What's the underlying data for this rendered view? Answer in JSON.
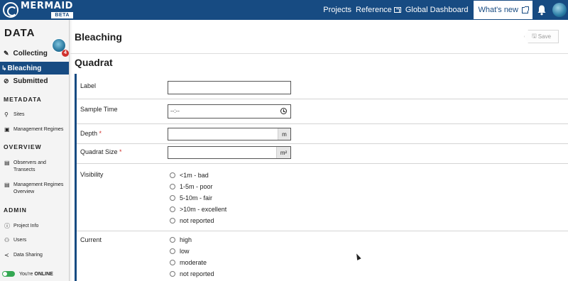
{
  "brand": {
    "name": "MERMAID",
    "badge": "BETA"
  },
  "nav": {
    "projects": "Projects",
    "reference": "Reference",
    "global_dashboard": "Global Dashboard",
    "whats_new": "What's new"
  },
  "sidebar": {
    "title": "DATA",
    "badge_count": "4",
    "collecting": "Collecting",
    "bleaching": "Bleaching",
    "submitted": "Submitted",
    "metadata_heading": "METADATA",
    "sites": "Sites",
    "management_regimes": "Management Regimes",
    "overview_heading": "OVERVIEW",
    "observers_transects": "Observers and Transects",
    "mr_overview": "Management Regimes Overview",
    "admin_heading": "ADMIN",
    "project_info": "Project Info",
    "users": "Users",
    "data_sharing": "Data Sharing",
    "online_prefix": "You're",
    "online_status": "ONLINE"
  },
  "page": {
    "title": "Bleaching",
    "save_label": "Save"
  },
  "form": {
    "section_title": "Quadrat",
    "label": {
      "label": "Label",
      "value": ""
    },
    "sample_time": {
      "label": "Sample Time",
      "value": "--:--"
    },
    "depth": {
      "label": "Depth",
      "required": "*",
      "unit": "m",
      "value": ""
    },
    "quadrat_size": {
      "label": "Quadrat Size",
      "required": "*",
      "unit": "m²",
      "value": ""
    },
    "visibility": {
      "label": "Visibility",
      "options": [
        "<1m - bad",
        "1-5m - poor",
        "5-10m - fair",
        ">10m - excellent",
        "not reported"
      ]
    },
    "current": {
      "label": "Current",
      "options": [
        "high",
        "low",
        "moderate",
        "not reported"
      ]
    }
  },
  "colors": {
    "brand": "#174b82",
    "required": "#d0312d",
    "online": "#35a853",
    "badge": "#d0312d"
  }
}
